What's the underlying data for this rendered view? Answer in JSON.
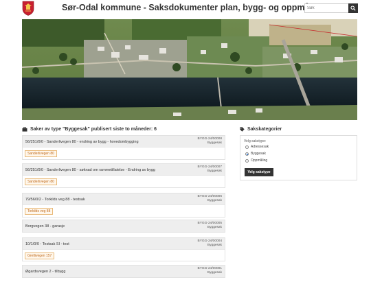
{
  "header": {
    "title": "Sør-Odal kommune - Saksdokumenter plan, bygg- og oppmåling",
    "search_placeholder": "Søk"
  },
  "cases_section": {
    "icon": "briefcase-icon",
    "title": "Saker av type \"Byggesak\" publisert siste to måneder: 6"
  },
  "cases": [
    {
      "title": "56/251/0/0 - Sanderlivegen 80 - endring av bygg - hovedombygging",
      "case_no": "BYGG-24/00008",
      "type": "Byggesak",
      "tag": "Sanderlivegen 80"
    },
    {
      "title": "56/251/0/0 - Sanderlivegen 80 - søknad om rammetillatelse - Endring av bygg",
      "case_no": "BYGG-24/00007",
      "type": "Byggesak",
      "tag": "Sanderlivegen 80"
    },
    {
      "title": "79/56/0/2 - Torkilds veg 88 - testsak",
      "case_no": "BYGG-24/00006",
      "type": "Byggesak",
      "tag": "Torkilds veg 88"
    },
    {
      "title": "Borgvegen 38 - garasje",
      "case_no": "BYGG-24/00005",
      "type": "Byggesak",
      "tag": ""
    },
    {
      "title": "10/1/0/0 - Testsak SI - test",
      "case_no": "BYGG-24/00004",
      "type": "Byggesak",
      "tag": "Gretlivegen 157"
    },
    {
      "title": "Øgardsvegen 2 - tilbygg",
      "case_no": "BYGG-24/00001",
      "type": "Byggesak",
      "tag": ""
    }
  ],
  "categories": {
    "icon": "tag-icon",
    "title": "Sakskategorier",
    "label": "Velg sakstype:",
    "options": [
      {
        "label": "Adressesak",
        "selected": false
      },
      {
        "label": "Byggesak",
        "selected": true
      },
      {
        "label": "Oppmåling",
        "selected": false
      }
    ],
    "submit_label": "Velg sakstype"
  },
  "colors": {
    "tag_text": "#c06a1a",
    "tag_border": "#e8b877",
    "dark_button": "#333333"
  }
}
